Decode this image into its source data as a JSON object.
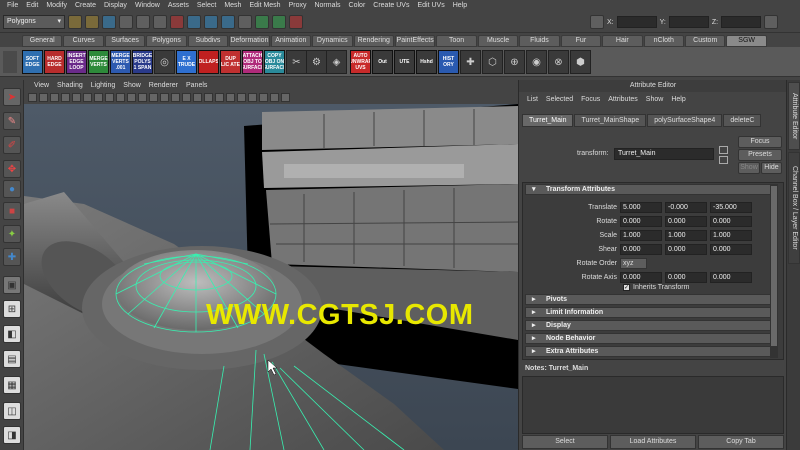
{
  "menubar": [
    "File",
    "Edit",
    "Modify",
    "Create",
    "Display",
    "Window",
    "Assets",
    "Select",
    "Mesh",
    "Edit Mesh",
    "Proxy",
    "Normals",
    "Color",
    "Create UVs",
    "Edit UVs",
    "Help"
  ],
  "status": {
    "mode": "Polygons",
    "x_label": "X:",
    "y_label": "Y:",
    "z_label": "Z:"
  },
  "shelf_tabs": [
    "General",
    "Curves",
    "Surfaces",
    "Polygons",
    "Subdivs",
    "Deformation",
    "Animation",
    "Dynamics",
    "Rendering",
    "PaintEffects",
    "Toon",
    "Muscle",
    "Fluids",
    "Fur",
    "Hair",
    "nCloth",
    "Custom",
    "SGW"
  ],
  "shelf_tab_active": "SGW",
  "shelf_buttons": [
    {
      "label": "SOFT EDGE",
      "color": "#2f6fb0"
    },
    {
      "label": "HARD EDGE",
      "color": "#b82c2c"
    },
    {
      "label": "INSERT EDGE LOOP",
      "color": "#6a2a8a"
    },
    {
      "label": "MERGE VERTS",
      "color": "#2d8a3a"
    },
    {
      "label": "MERGE VERTS .001",
      "color": "#2d5ab0"
    },
    {
      "label": "BRIDGE POLYS 1 SPAN",
      "color": "#2a3a8a"
    },
    {
      "label": "E X TRUDE",
      "color": "#2e6fd0"
    },
    {
      "label": "COLLAPSE",
      "color": "#c02020"
    },
    {
      "label": "DUP LIC ATE",
      "color": "#c03030"
    },
    {
      "label": "ATTACH OBJ TO SURFACE",
      "color": "#b02a7a"
    },
    {
      "label": "COPY OBJ ON SURFACE",
      "color": "#2a8a9a"
    },
    {
      "label": "AUTO UNWRAP UVS",
      "color": "#c82a2a"
    },
    {
      "label": "Out",
      "color": "#3a3a3a"
    },
    {
      "label": "UTE",
      "color": "#3a3a3a"
    },
    {
      "label": "Hshd",
      "color": "#3a3a3a"
    },
    {
      "label": "HIST ORY",
      "color": "#2a5ab0"
    }
  ],
  "panel_menu": [
    "View",
    "Shading",
    "Lighting",
    "Show",
    "Renderer",
    "Panels"
  ],
  "watermark": "WWW.CGTSJ.COM",
  "attr_editor": {
    "title": "Attribute Editor",
    "menu": [
      "List",
      "Selected",
      "Focus",
      "Attributes",
      "Show",
      "Help"
    ],
    "tabs": [
      "Turret_Main",
      "Turret_MainShape",
      "polySurfaceShape4",
      "deleteC"
    ],
    "transform_label": "transform:",
    "transform_value": "Turret_Main",
    "focus": "Focus",
    "presets": "Presets",
    "show": "Show",
    "hide": "Hide",
    "section_transform": "Transform Attributes",
    "rows": [
      {
        "label": "Translate",
        "values": [
          "5.000",
          "-0.000",
          "-35.000"
        ]
      },
      {
        "label": "Rotate",
        "values": [
          "0.000",
          "0.000",
          "0.000"
        ]
      },
      {
        "label": "Scale",
        "values": [
          "1.000",
          "1.000",
          "1.000"
        ]
      },
      {
        "label": "Shear",
        "values": [
          "0.000",
          "0.000",
          "0.000"
        ]
      }
    ],
    "rotate_order_label": "Rotate Order",
    "rotate_order_value": "xyz",
    "rotate_axis_label": "Rotate Axis",
    "rotate_axis_values": [
      "0.000",
      "0.000",
      "0.000"
    ],
    "inherits_label": "Inherits Transform",
    "sections_closed": [
      "Pivots",
      "Limit Information",
      "Display",
      "Node Behavior",
      "Extra Attributes"
    ],
    "notes_label": "Notes: Turret_Main",
    "bottom": [
      "Select",
      "Load Attributes",
      "Copy Tab"
    ]
  },
  "side_tabs": [
    "Attribute Editor",
    "Channel Box / Layer Editor"
  ]
}
